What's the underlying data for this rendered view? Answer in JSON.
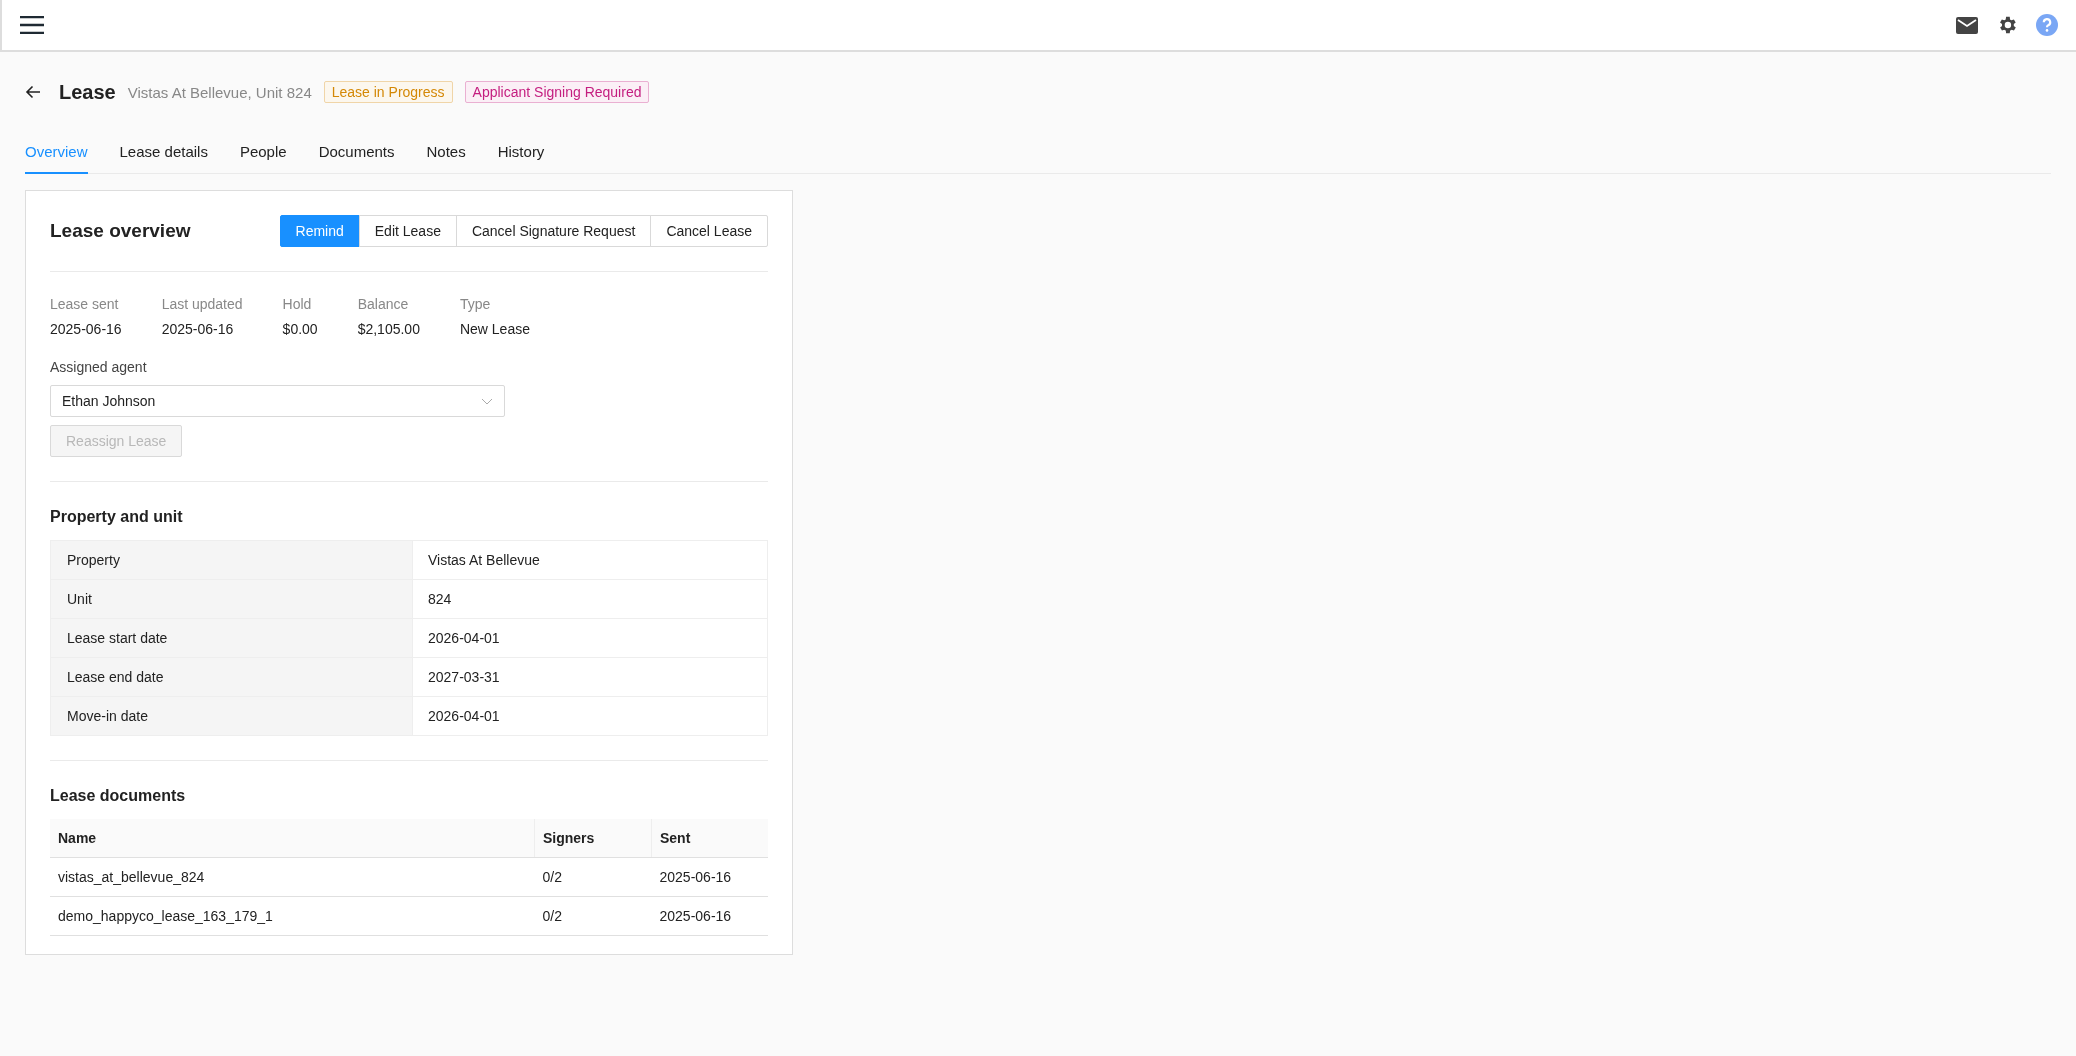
{
  "header": {
    "title": "Lease",
    "subtitle": "Vistas At Bellevue, Unit 824",
    "badges": [
      {
        "label": "Lease in Progress",
        "color": "#d48806"
      },
      {
        "label": "Applicant Signing Required",
        "color": "#c41d7f"
      }
    ]
  },
  "tabs": [
    {
      "label": "Overview",
      "selected": true
    },
    {
      "label": "Lease details",
      "selected": false
    },
    {
      "label": "People",
      "selected": false
    },
    {
      "label": "Documents",
      "selected": false
    },
    {
      "label": "Notes",
      "selected": false
    },
    {
      "label": "History",
      "selected": false
    }
  ],
  "overview": {
    "title": "Lease overview",
    "buttons": [
      {
        "label": "Remind",
        "kind": "primary"
      },
      {
        "label": "Edit Lease",
        "kind": "default"
      },
      {
        "label": "Cancel Signature Request",
        "kind": "default"
      },
      {
        "label": "Cancel Lease",
        "kind": "default"
      }
    ],
    "facts": [
      {
        "label": "Lease sent",
        "value": "2025-06-16"
      },
      {
        "label": "Last updated",
        "value": "2025-06-16"
      },
      {
        "label": "Hold",
        "value": "$0.00"
      },
      {
        "label": "Balance",
        "value": "$2,105.00"
      },
      {
        "label": "Type",
        "value": "New Lease"
      }
    ],
    "assigned_agent": {
      "label": "Assigned agent",
      "value": "Ethan Johnson"
    },
    "reassign_button": {
      "label": "Reassign Lease",
      "disabled": true
    }
  },
  "property_and_unit": {
    "title": "Property and unit",
    "rows": [
      {
        "label": "Property",
        "value": "Vistas At Bellevue"
      },
      {
        "label": "Unit",
        "value": "824"
      },
      {
        "label": "Lease start date",
        "value": "2026-04-01"
      },
      {
        "label": "Lease end date",
        "value": "2027-03-31"
      },
      {
        "label": "Move-in date",
        "value": "2026-04-01"
      }
    ]
  },
  "lease_documents": {
    "title": "Lease documents",
    "columns": [
      "Name",
      "Signers",
      "Sent"
    ],
    "rows": [
      [
        "vistas_at_bellevue_824",
        "0/2",
        "2025-06-16"
      ],
      [
        "demo_happyco_lease_163_179_1",
        "0/2",
        "2025-06-16"
      ]
    ]
  }
}
